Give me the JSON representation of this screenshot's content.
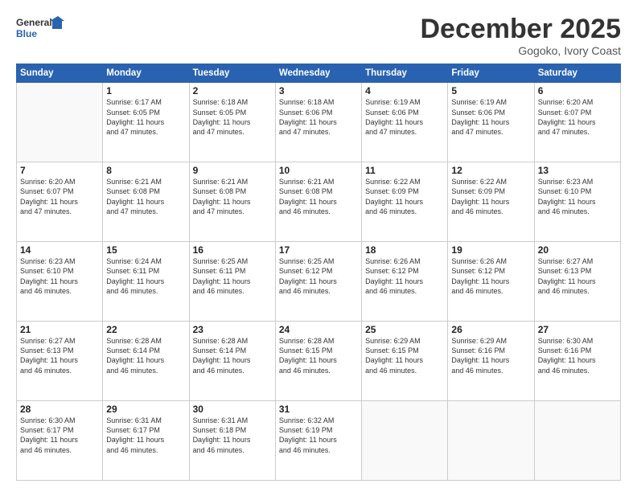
{
  "logo": {
    "line1": "General",
    "line2": "Blue"
  },
  "title": "December 2025",
  "subtitle": "Gogoko, Ivory Coast",
  "days_header": [
    "Sunday",
    "Monday",
    "Tuesday",
    "Wednesday",
    "Thursday",
    "Friday",
    "Saturday"
  ],
  "weeks": [
    [
      {
        "day": "",
        "info": ""
      },
      {
        "day": "1",
        "info": "Sunrise: 6:17 AM\nSunset: 6:05 PM\nDaylight: 11 hours\nand 47 minutes."
      },
      {
        "day": "2",
        "info": "Sunrise: 6:18 AM\nSunset: 6:05 PM\nDaylight: 11 hours\nand 47 minutes."
      },
      {
        "day": "3",
        "info": "Sunrise: 6:18 AM\nSunset: 6:06 PM\nDaylight: 11 hours\nand 47 minutes."
      },
      {
        "day": "4",
        "info": "Sunrise: 6:19 AM\nSunset: 6:06 PM\nDaylight: 11 hours\nand 47 minutes."
      },
      {
        "day": "5",
        "info": "Sunrise: 6:19 AM\nSunset: 6:06 PM\nDaylight: 11 hours\nand 47 minutes."
      },
      {
        "day": "6",
        "info": "Sunrise: 6:20 AM\nSunset: 6:07 PM\nDaylight: 11 hours\nand 47 minutes."
      }
    ],
    [
      {
        "day": "7",
        "info": "Sunrise: 6:20 AM\nSunset: 6:07 PM\nDaylight: 11 hours\nand 47 minutes."
      },
      {
        "day": "8",
        "info": "Sunrise: 6:21 AM\nSunset: 6:08 PM\nDaylight: 11 hours\nand 47 minutes."
      },
      {
        "day": "9",
        "info": "Sunrise: 6:21 AM\nSunset: 6:08 PM\nDaylight: 11 hours\nand 47 minutes."
      },
      {
        "day": "10",
        "info": "Sunrise: 6:21 AM\nSunset: 6:08 PM\nDaylight: 11 hours\nand 46 minutes."
      },
      {
        "day": "11",
        "info": "Sunrise: 6:22 AM\nSunset: 6:09 PM\nDaylight: 11 hours\nand 46 minutes."
      },
      {
        "day": "12",
        "info": "Sunrise: 6:22 AM\nSunset: 6:09 PM\nDaylight: 11 hours\nand 46 minutes."
      },
      {
        "day": "13",
        "info": "Sunrise: 6:23 AM\nSunset: 6:10 PM\nDaylight: 11 hours\nand 46 minutes."
      }
    ],
    [
      {
        "day": "14",
        "info": "Sunrise: 6:23 AM\nSunset: 6:10 PM\nDaylight: 11 hours\nand 46 minutes."
      },
      {
        "day": "15",
        "info": "Sunrise: 6:24 AM\nSunset: 6:11 PM\nDaylight: 11 hours\nand 46 minutes."
      },
      {
        "day": "16",
        "info": "Sunrise: 6:25 AM\nSunset: 6:11 PM\nDaylight: 11 hours\nand 46 minutes."
      },
      {
        "day": "17",
        "info": "Sunrise: 6:25 AM\nSunset: 6:12 PM\nDaylight: 11 hours\nand 46 minutes."
      },
      {
        "day": "18",
        "info": "Sunrise: 6:26 AM\nSunset: 6:12 PM\nDaylight: 11 hours\nand 46 minutes."
      },
      {
        "day": "19",
        "info": "Sunrise: 6:26 AM\nSunset: 6:12 PM\nDaylight: 11 hours\nand 46 minutes."
      },
      {
        "day": "20",
        "info": "Sunrise: 6:27 AM\nSunset: 6:13 PM\nDaylight: 11 hours\nand 46 minutes."
      }
    ],
    [
      {
        "day": "21",
        "info": "Sunrise: 6:27 AM\nSunset: 6:13 PM\nDaylight: 11 hours\nand 46 minutes."
      },
      {
        "day": "22",
        "info": "Sunrise: 6:28 AM\nSunset: 6:14 PM\nDaylight: 11 hours\nand 46 minutes."
      },
      {
        "day": "23",
        "info": "Sunrise: 6:28 AM\nSunset: 6:14 PM\nDaylight: 11 hours\nand 46 minutes."
      },
      {
        "day": "24",
        "info": "Sunrise: 6:28 AM\nSunset: 6:15 PM\nDaylight: 11 hours\nand 46 minutes."
      },
      {
        "day": "25",
        "info": "Sunrise: 6:29 AM\nSunset: 6:15 PM\nDaylight: 11 hours\nand 46 minutes."
      },
      {
        "day": "26",
        "info": "Sunrise: 6:29 AM\nSunset: 6:16 PM\nDaylight: 11 hours\nand 46 minutes."
      },
      {
        "day": "27",
        "info": "Sunrise: 6:30 AM\nSunset: 6:16 PM\nDaylight: 11 hours\nand 46 minutes."
      }
    ],
    [
      {
        "day": "28",
        "info": "Sunrise: 6:30 AM\nSunset: 6:17 PM\nDaylight: 11 hours\nand 46 minutes."
      },
      {
        "day": "29",
        "info": "Sunrise: 6:31 AM\nSunset: 6:17 PM\nDaylight: 11 hours\nand 46 minutes."
      },
      {
        "day": "30",
        "info": "Sunrise: 6:31 AM\nSunset: 6:18 PM\nDaylight: 11 hours\nand 46 minutes."
      },
      {
        "day": "31",
        "info": "Sunrise: 6:32 AM\nSunset: 6:19 PM\nDaylight: 11 hours\nand 46 minutes."
      },
      {
        "day": "",
        "info": ""
      },
      {
        "day": "",
        "info": ""
      },
      {
        "day": "",
        "info": ""
      }
    ]
  ]
}
